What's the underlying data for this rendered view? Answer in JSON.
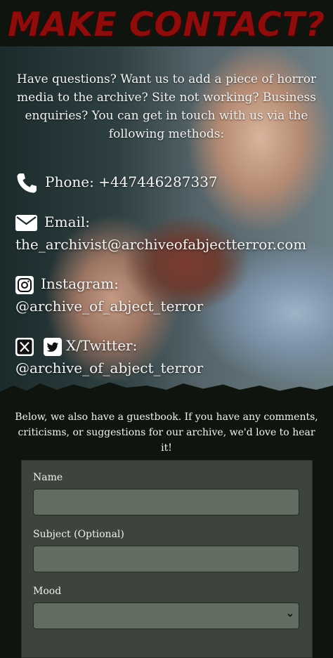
{
  "page_title": "MAKE CONTACT?",
  "intro": "Have questions? Want us to add a piece of horror media to the archive? Site not working? Business enquiries? You can get in touch with us via the following methods:",
  "contacts": {
    "phone": {
      "label": "Phone:",
      "value": "+447446287337",
      "icon": "phone-icon"
    },
    "email": {
      "label": "Email:",
      "value": "the_archivist@archiveofabjectterror.com",
      "icon": "envelope-icon"
    },
    "instagram": {
      "label": "Instagram:",
      "value": "@archive_of_abject_terror",
      "icon": "instagram-icon"
    },
    "twitter": {
      "label": "X/Twitter:",
      "value": "@archive_of_abject_terror",
      "icons": [
        "x-icon",
        "twitter-bird-icon"
      ]
    }
  },
  "guestbook_note": "Below, we also have a guestbook. If you have any comments, criticisms, or suggestions for our archive, we'd love to hear it!",
  "form": {
    "name_label": "Name",
    "subject_label": "Subject (Optional)",
    "mood_label": "Mood",
    "name_value": "",
    "subject_value": "",
    "mood_value": ""
  },
  "colors": {
    "title": "#8e0c0c",
    "background": "#0f140f",
    "form_panel": "#3d433d",
    "field": "#626d62"
  }
}
